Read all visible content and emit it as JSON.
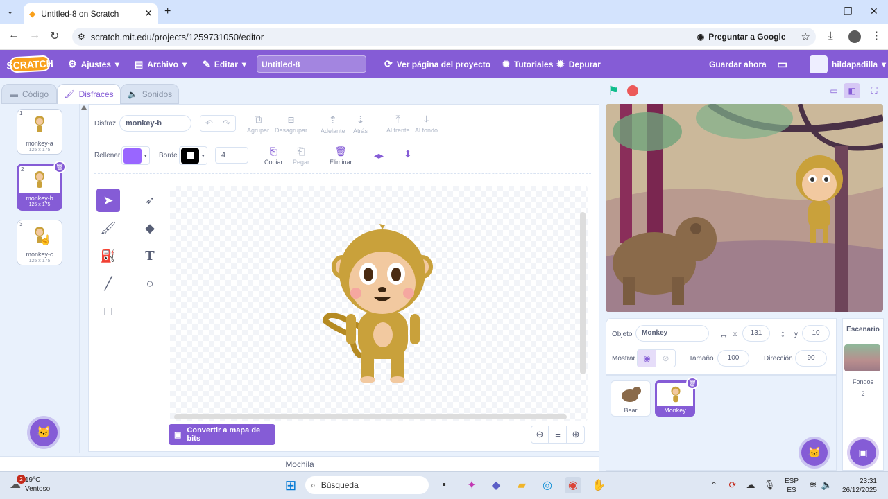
{
  "browser": {
    "tab_title": "Untitled-8 on Scratch",
    "url": "scratch.mit.edu/projects/1259731050/editor",
    "ask_google": "Preguntar a Google"
  },
  "menubar": {
    "logo": "SCRATCH",
    "settings": "Ajustes",
    "file": "Archivo",
    "edit": "Editar",
    "project_title": "Untitled-8",
    "see_project_page": "Ver página del proyecto",
    "tutorials": "Tutoriales",
    "debug": "Depurar",
    "save_now": "Guardar ahora",
    "username": "hildapadilla"
  },
  "tabs": {
    "code": "Código",
    "costumes": "Disfraces",
    "sounds": "Sonidos"
  },
  "costumes": [
    {
      "num": "1",
      "name": "monkey-a",
      "size": "125 x 175"
    },
    {
      "num": "2",
      "name": "monkey-b",
      "size": "125 x 175"
    },
    {
      "num": "3",
      "name": "monkey-c",
      "size": "125 x 175"
    }
  ],
  "editor": {
    "costume_label": "Disfraz",
    "costume_name": "monkey-b",
    "group": "Agrupar",
    "ungroup": "Desagrupar",
    "forward": "Adelante",
    "backward": "Atrás",
    "front": "Al frente",
    "back": "Al fondo",
    "fill_label": "Rellenar",
    "fill_color": "#9966ff",
    "border_label": "Borde",
    "border_color": "#000000",
    "border_width": "4",
    "copy": "Copiar",
    "paste": "Pegar",
    "delete": "Eliminar",
    "convert_bitmap": "Convertir a mapa de bits",
    "zoom_reset": "="
  },
  "backpack": "Mochila",
  "sprite_info": {
    "object_label": "Objeto",
    "object_name": "Monkey",
    "x_label": "x",
    "x": "131",
    "y_label": "y",
    "y": "10",
    "show_label": "Mostrar",
    "size_label": "Tamaño",
    "size": "100",
    "direction_label": "Dirección",
    "direction": "90"
  },
  "sprites": [
    {
      "name": "Bear"
    },
    {
      "name": "Monkey"
    }
  ],
  "stage_panel": {
    "title": "Escenario",
    "backdrops_label": "Fondos",
    "backdrops_count": "2"
  },
  "taskbar": {
    "weather_badge": "2",
    "temp": "19°C",
    "weather": "Ventoso",
    "search": "Búsqueda",
    "lang1": "ESP",
    "lang2": "ES",
    "time": "23:31",
    "date": "26/12/2025"
  },
  "colors": {
    "accent": "#855cd6",
    "ui_blue": "#e9f1fc"
  }
}
